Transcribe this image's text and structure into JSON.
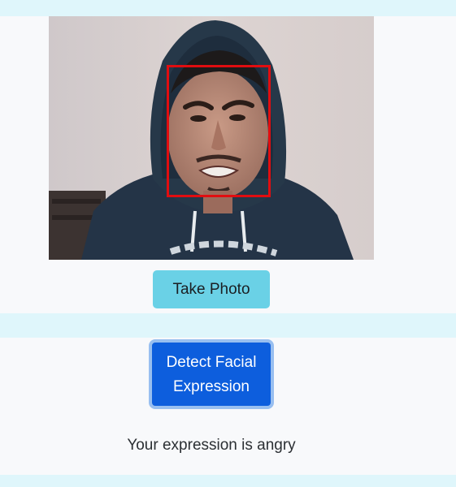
{
  "camera": {
    "face_detected": true,
    "box_color": "#e10d10"
  },
  "take_photo": {
    "label": "Take Photo",
    "color": "#6ad1e6"
  },
  "detect": {
    "label": "Detect Facial Expression",
    "color": "#0d5edd"
  },
  "result": {
    "text": "Your expression is angry"
  }
}
